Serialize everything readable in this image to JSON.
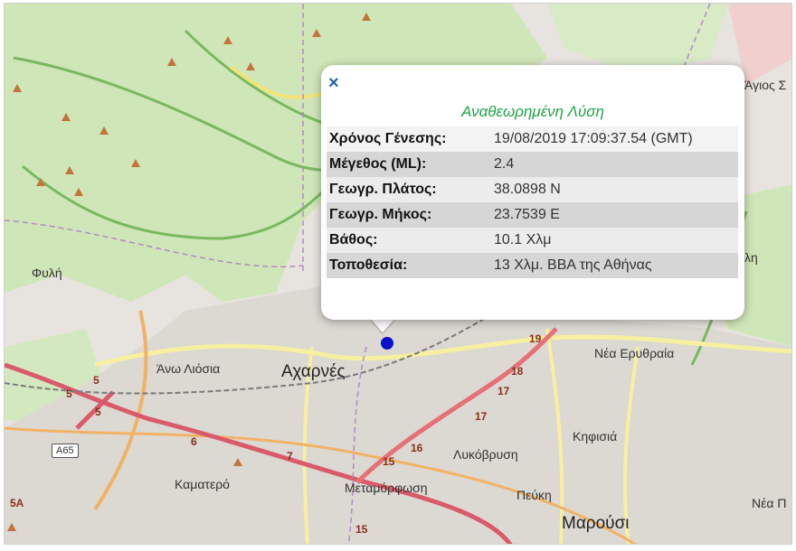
{
  "popup": {
    "close_symbol": "×",
    "title": "Αναθεωρημένη Λύση",
    "rows": [
      {
        "label": "Χρόνος Γένεσης:",
        "value": "19/08/2019 17:09:37.54 (GMT)"
      },
      {
        "label": "Μέγεθος (ML):",
        "value": "2.4"
      },
      {
        "label": "Γεωγρ. Πλάτος:",
        "value": "38.0898 N"
      },
      {
        "label": "Γεωγρ. Μήκος:",
        "value": "23.7539 E"
      },
      {
        "label": "Βάθος:",
        "value": "10.1 Χλμ"
      },
      {
        "label": "Τοποθεσία:",
        "value": "13 Χλμ. ΒΒΑ της Αθήνας"
      }
    ]
  },
  "places": {
    "fyli": "Φυλή",
    "ano_liosia": "Άνω Λιόσια",
    "acharnes": "Αχαρνές",
    "nea_erythraia": "Νέα Ερυθραία",
    "kifisia": "Κηφισιά",
    "lykovrysi": "Λυκόβρυση",
    "kamatero": "Καματερό",
    "metamorfosi": "Μεταμόρφωση",
    "pefki": "Πεύκη",
    "marousi": "Μαρούσι",
    "agios_stefanos": "Άγιος Σ",
    "nea_p": "Νέα Π",
    "lh": "λη"
  },
  "roads": {
    "a65": "A65",
    "n5a": "5",
    "n5b": "5",
    "n5c": "5",
    "n6": "6",
    "n7": "7",
    "n15": "15",
    "n16": "16",
    "n17a": "17",
    "n17b": "17",
    "n18": "18",
    "n19": "19",
    "n15b": "15",
    "n5A": "5A"
  },
  "colors": {
    "marker": "#0a11c9",
    "popup_title": "#22a34a",
    "close": "#2a5fa6"
  }
}
